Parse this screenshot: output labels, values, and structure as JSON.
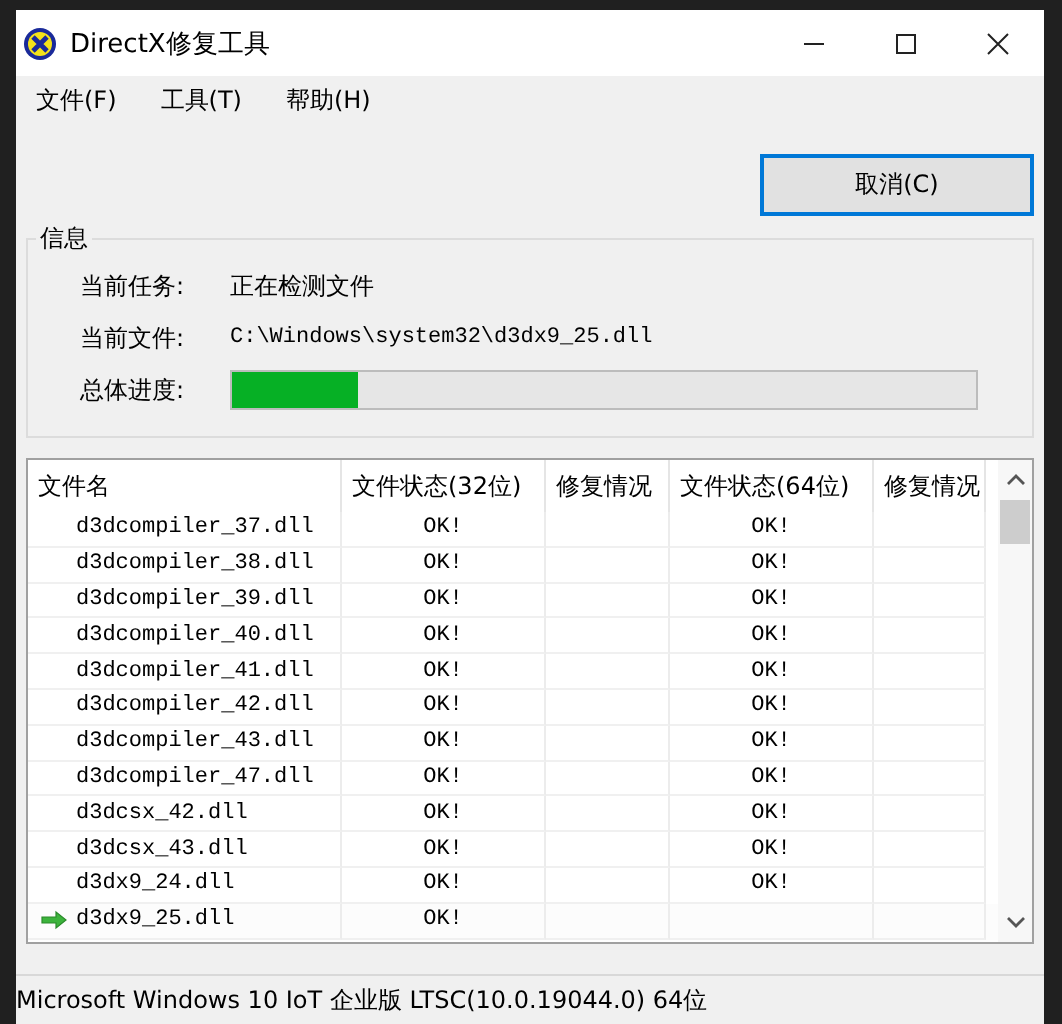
{
  "window": {
    "title": "DirectX修复工具"
  },
  "menu": [
    "文件(F)",
    "工具(T)",
    "帮助(H)"
  ],
  "cancel_button": "取消(C)",
  "info": {
    "title": "信息",
    "fields": [
      {
        "label": "当前任务:",
        "value": "正在检测文件",
        "kind": "text"
      },
      {
        "label": "当前文件:",
        "value": "C:\\Windows\\system32\\d3dx9_25.dll",
        "kind": "path"
      },
      {
        "label": "总体进度:",
        "kind": "progress",
        "level": 0.17
      }
    ]
  },
  "table": {
    "columns": [
      "文件名",
      "文件状态(32位)",
      "修复情况",
      "文件状态(64位)",
      "修复情况"
    ],
    "rows": [
      {
        "name": "d3dcompiler_37.dll",
        "status32": "OK!",
        "status64": "OK!",
        "current": false
      },
      {
        "name": "d3dcompiler_38.dll",
        "status32": "OK!",
        "status64": "OK!",
        "current": false
      },
      {
        "name": "d3dcompiler_39.dll",
        "status32": "OK!",
        "status64": "OK!",
        "current": false
      },
      {
        "name": "d3dcompiler_40.dll",
        "status32": "OK!",
        "status64": "OK!",
        "current": false
      },
      {
        "name": "d3dcompiler_41.dll",
        "status32": "OK!",
        "status64": "OK!",
        "current": false
      },
      {
        "name": "d3dcompiler_42.dll",
        "status32": "OK!",
        "status64": "OK!",
        "current": false
      },
      {
        "name": "d3dcompiler_43.dll",
        "status32": "OK!",
        "status64": "OK!",
        "current": false
      },
      {
        "name": "d3dcompiler_47.dll",
        "status32": "OK!",
        "status64": "OK!",
        "current": false
      },
      {
        "name": "d3dcsx_42.dll",
        "status32": "OK!",
        "status64": "OK!",
        "current": false
      },
      {
        "name": "d3dcsx_43.dll",
        "status32": "OK!",
        "status64": "OK!",
        "current": false
      },
      {
        "name": "d3dx9_24.dll",
        "status32": "OK!",
        "status64": "OK!",
        "current": false
      },
      {
        "name": "d3dx9_25.dll",
        "status32": "OK!",
        "current": true
      }
    ]
  },
  "status_bar": "Microsoft Windows 10 IoT 企业版 LTSC(10.0.19044.0) 64位"
}
